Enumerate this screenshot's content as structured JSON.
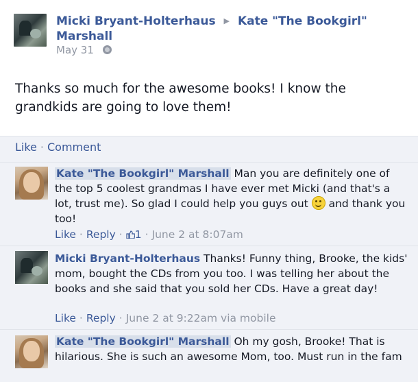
{
  "post": {
    "author": "Micki Bryant-Holterhaus",
    "recipient": "Kate \"The Bookgirl\" Marshall",
    "date": "May 31",
    "body": "Thanks so much for the awesome books! I know the grandkids are going to love them!"
  },
  "actions": {
    "like": "Like",
    "comment": "Comment"
  },
  "comments": [
    {
      "author": "Kate \"The Bookgirl\" Marshall",
      "text": "Man you are definitely one of the top 5 coolest grandmas I have ever met Micki (and that's a lot, trust me). So glad I could help you guys out",
      "text_after": "and thank you too!",
      "like": "Like",
      "reply": "Reply",
      "likes_count": "1",
      "timestamp": "June 2 at 8:07am"
    },
    {
      "author": "Micki Bryant-Holterhaus",
      "text": "Thanks! Funny thing, Brooke, the kids' mom, bought the CDs from you too. I was telling her about the books and she said that you sold her CDs. Have a great day!",
      "like": "Like",
      "reply": "Reply",
      "timestamp": "June 2 at 9:22am via mobile"
    },
    {
      "author": "Kate \"The Bookgirl\" Marshall",
      "text": "Oh my gosh, Brooke! That is hilarious. She is such an awesome Mom, too. Must run in the fam"
    }
  ],
  "icons": {
    "arrow": "triangle-right-icon",
    "globe": "globe-icon",
    "thumb": "thumbs-up-icon",
    "smiley": "smiley-emoticon"
  },
  "colors": {
    "link": "#3b5998",
    "meta": "#9197a3",
    "comment_bg": "#f0f2f7",
    "highlight": "#d8dfea"
  }
}
